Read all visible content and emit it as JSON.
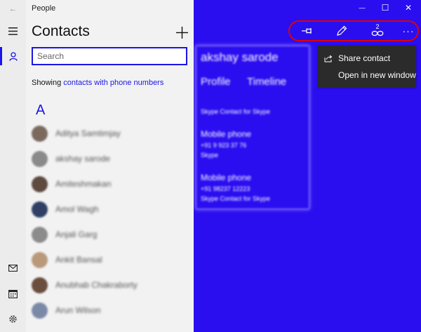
{
  "window": {
    "app_title": "People",
    "back_glyph": "←",
    "minimize_glyph": "—",
    "maximize_glyph": "☐",
    "close_glyph": "✕"
  },
  "rail": {
    "items": [
      {
        "icon": "hamburger-icon"
      },
      {
        "icon": "person-icon",
        "selected": true
      },
      {
        "icon": "mail-icon"
      },
      {
        "icon": "calendar-icon"
      },
      {
        "icon": "settings-icon"
      }
    ]
  },
  "contacts_pane": {
    "title": "Contacts",
    "add_icon": "plus-icon",
    "search_placeholder": "Search",
    "showing_prefix": "Showing",
    "showing_link": "contacts with phone numbers",
    "group_letter": "A",
    "contacts": [
      {
        "name": "Aditya Samtimjay",
        "avatar_color": "#7a6a5e"
      },
      {
        "name": "akshay sarode",
        "avatar_color": "#8a8a8a"
      },
      {
        "name": "Amiteshmakan",
        "avatar_color": "#5e4a3e"
      },
      {
        "name": "Amol Wagh",
        "avatar_color": "#2f3f66"
      },
      {
        "name": "Anjali Garg",
        "avatar_color": "#8c8c8c"
      },
      {
        "name": "Ankit Bansal",
        "avatar_color": "#b89a7a"
      },
      {
        "name": "Anubhab Chakraborty",
        "avatar_color": "#6a4e3e"
      },
      {
        "name": "Arun Wilson",
        "avatar_color": "#7a8aa6"
      }
    ]
  },
  "toolbar": {
    "pin_icon": "pin-icon",
    "edit_icon": "pencil-icon",
    "link_icon": "link-icon",
    "link_count": "2",
    "more_glyph": "···"
  },
  "contact_card": {
    "name": "akshay sarode",
    "tab_profile": "Profile",
    "tab_timeline": "Timeline",
    "line1": "Skype Contact for Skype",
    "mobile_label_1": "Mobile phone",
    "mobile_value_1": "+91 9 923 37 76",
    "mobile_sub_1": "Skype",
    "mobile_label_2": "Mobile phone",
    "mobile_value_2": "+91 98237 12223",
    "mobile_sub_2": "Skype Contact for Skype"
  },
  "more_menu": {
    "items": [
      {
        "label": "Share contact",
        "icon": "share-icon"
      },
      {
        "label": "Open in new window",
        "icon": ""
      }
    ]
  },
  "colors": {
    "accent": "#1a15e8",
    "detail_bg": "#2b0ef0",
    "highlight_oval": "#e00000",
    "menu_bg": "#2b2b2b"
  }
}
